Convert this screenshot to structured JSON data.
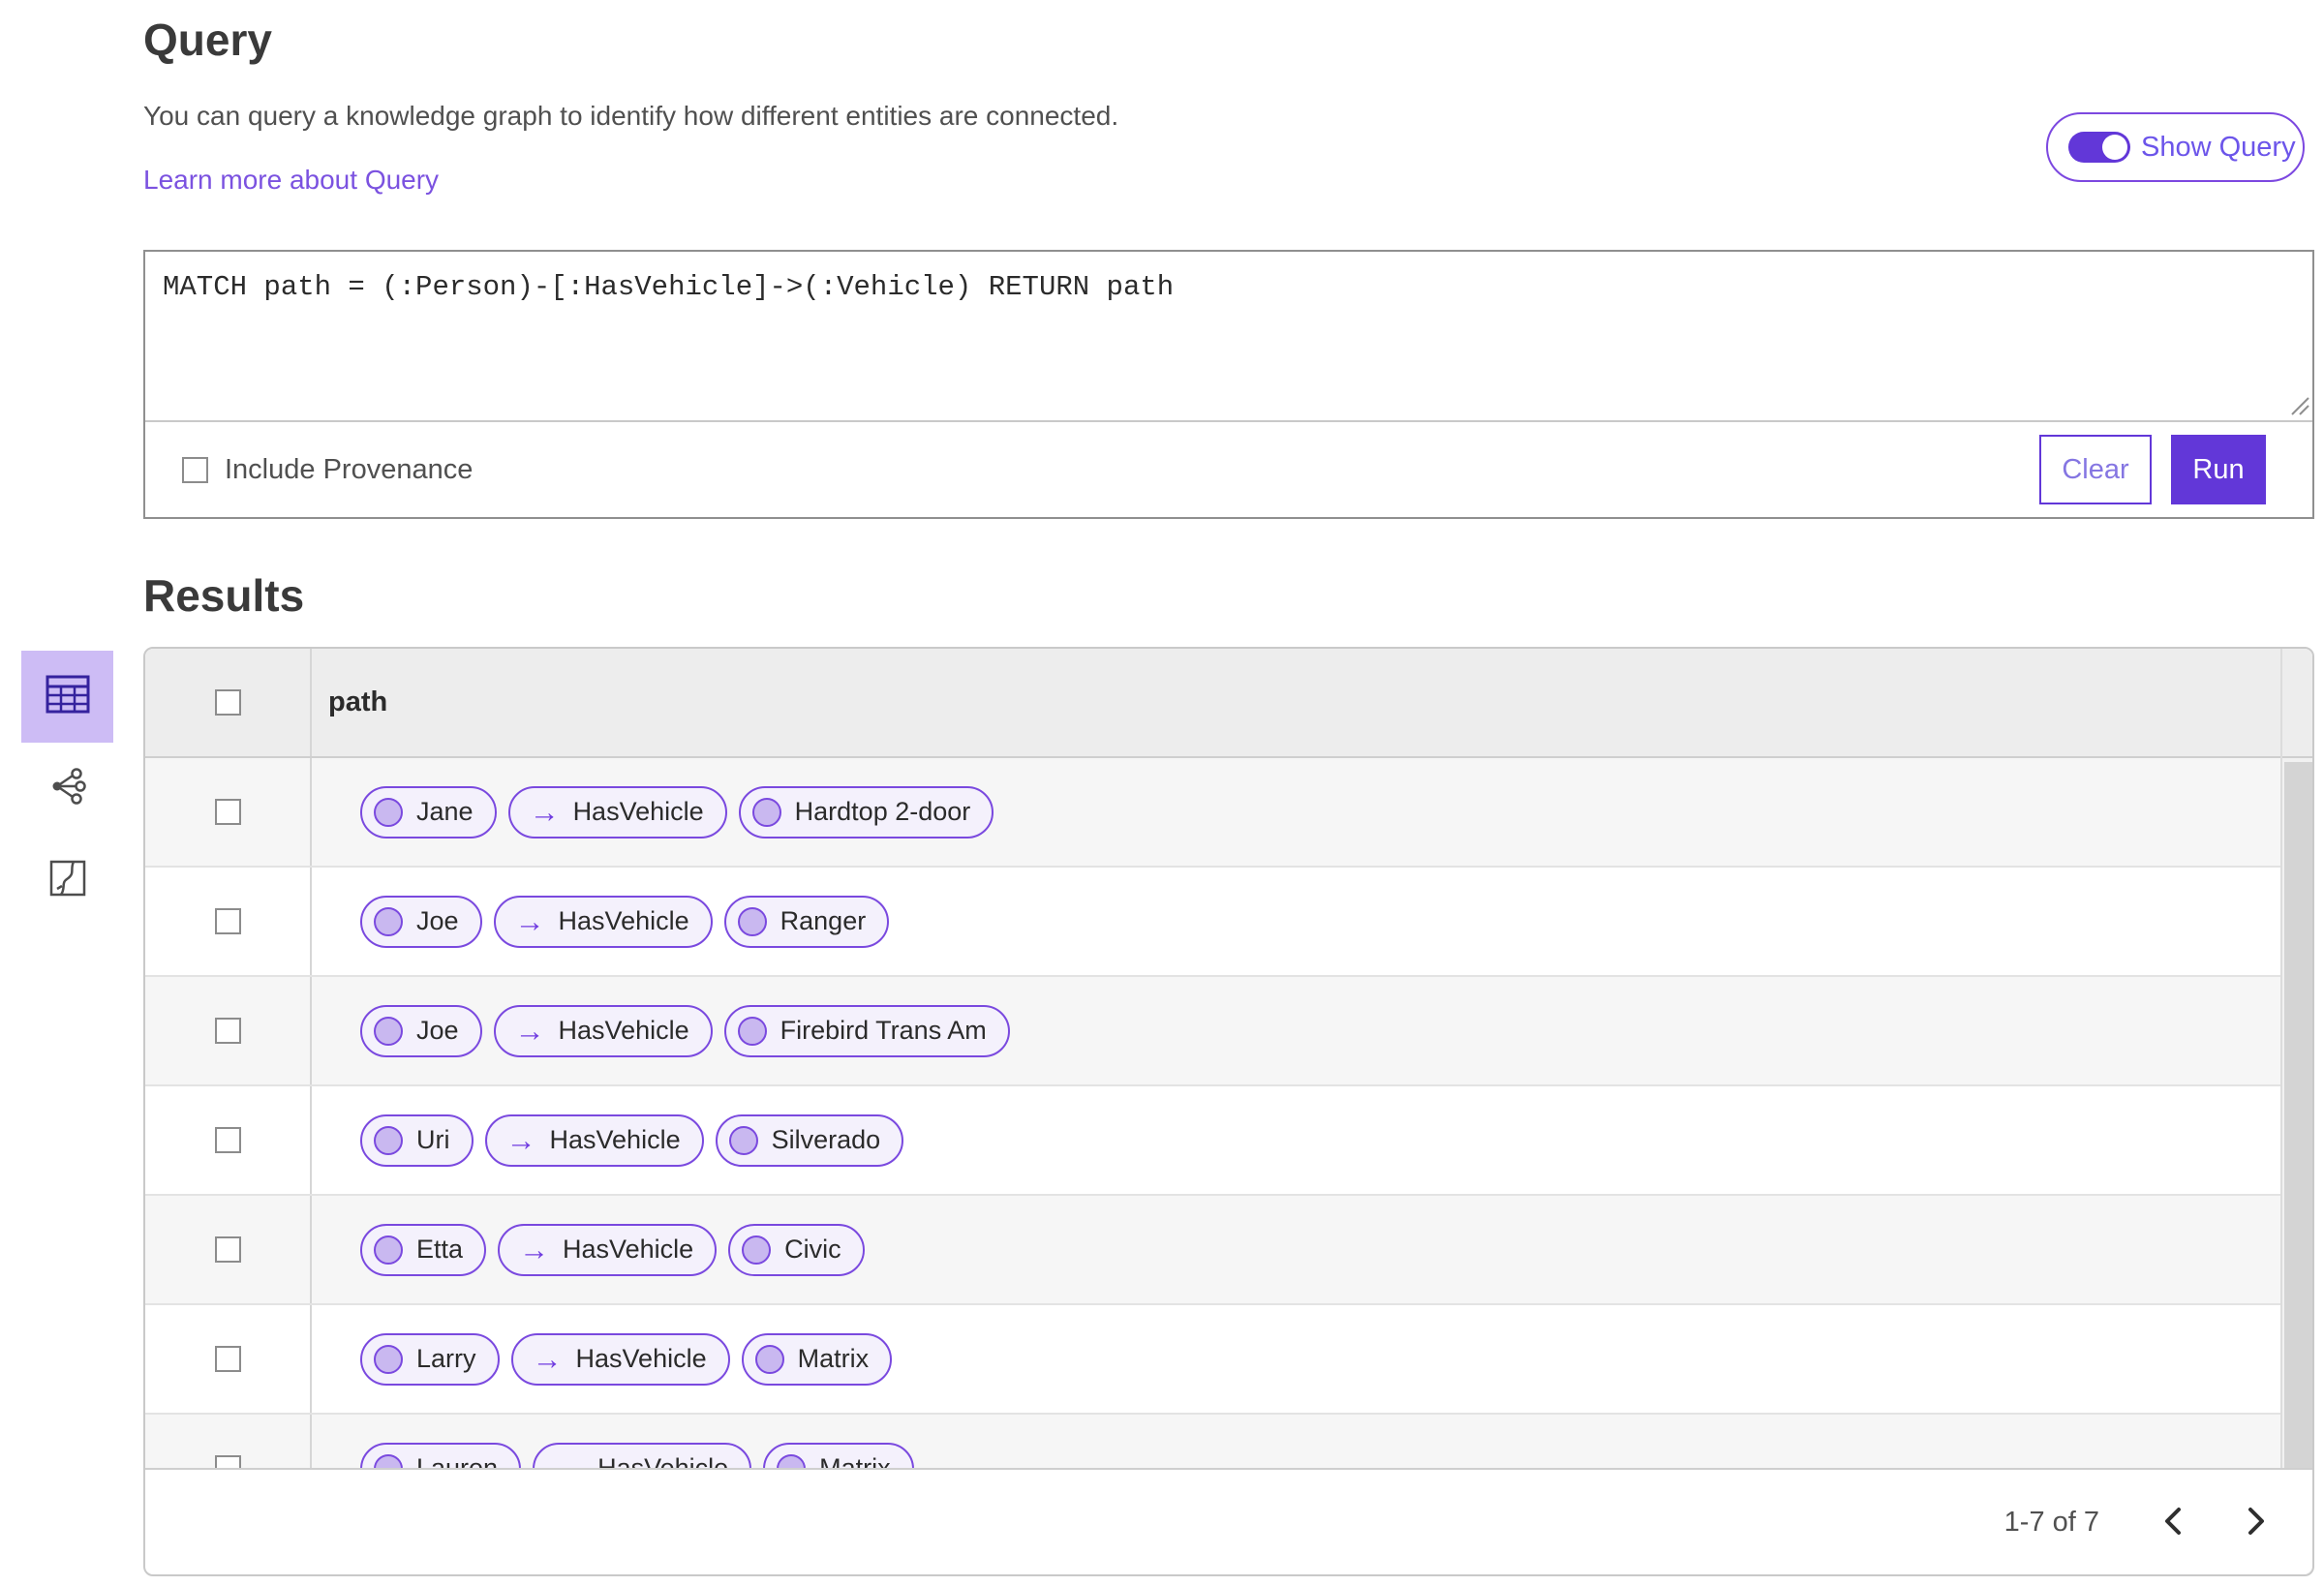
{
  "colors": {
    "primary": "#6237d8",
    "pill-border": "#7a49df",
    "pill-bg": "#f4f1fc",
    "node-fill": "#c9b8f0",
    "selected-view-bg": "#cdbcf5",
    "selected-view-icon": "#35229e",
    "link": "#7b52e0",
    "toggle-label": "#6c55ea"
  },
  "query_section": {
    "title": "Query",
    "description": "You can query a knowledge graph to identify how different entities are connected.",
    "learn_more_label": "Learn more about Query",
    "show_query_label": "Show Query",
    "show_query_on": true,
    "query_text": "MATCH path = (:Person)-[:HasVehicle]->(:Vehicle) RETURN path",
    "include_provenance_label": "Include Provenance",
    "include_provenance_checked": false,
    "clear_button_label": "Clear",
    "run_button_label": "Run"
  },
  "results_section": {
    "title": "Results",
    "path_column_header": "path",
    "arrow_glyph": "→",
    "rows": [
      {
        "source": "Jane",
        "relationship": "HasVehicle",
        "target": "Hardtop 2-door"
      },
      {
        "source": "Joe",
        "relationship": "HasVehicle",
        "target": "Ranger"
      },
      {
        "source": "Joe",
        "relationship": "HasVehicle",
        "target": "Firebird Trans Am"
      },
      {
        "source": "Uri",
        "relationship": "HasVehicle",
        "target": "Silverado"
      },
      {
        "source": "Etta",
        "relationship": "HasVehicle",
        "target": "Civic"
      },
      {
        "source": "Larry",
        "relationship": "HasVehicle",
        "target": "Matrix"
      },
      {
        "source": "Lauren",
        "relationship": "HasVehicle",
        "target": "Matrix"
      }
    ],
    "pagination": {
      "range_label": "1-7 of 7"
    }
  },
  "view_rail": {
    "items": [
      {
        "name": "table-view",
        "icon": "table-icon",
        "selected": true
      },
      {
        "name": "link-chart-view",
        "icon": "link-chart-icon",
        "selected": false
      },
      {
        "name": "map-view",
        "icon": "map-icon",
        "selected": false
      }
    ]
  }
}
